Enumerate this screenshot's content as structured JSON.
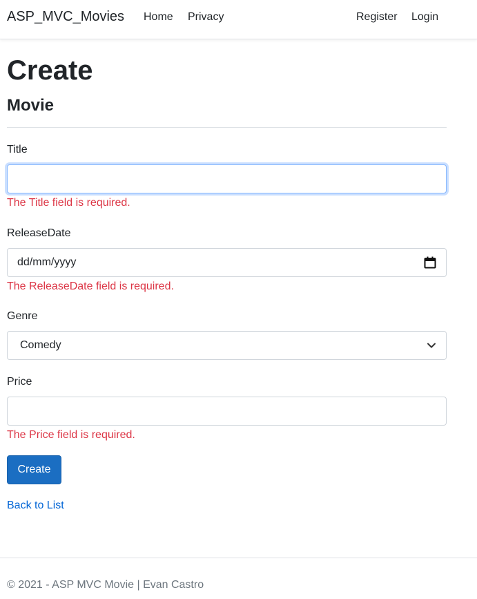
{
  "navbar": {
    "brand": "ASP_MVC_Movies",
    "links": [
      "Home",
      "Privacy"
    ],
    "auth_links": [
      "Register",
      "Login"
    ]
  },
  "page": {
    "title": "Create",
    "subtitle": "Movie"
  },
  "form": {
    "title": {
      "label": "Title",
      "value": "",
      "error": "The Title field is required."
    },
    "release_date": {
      "label": "ReleaseDate",
      "placeholder": "dd/mm/yyyy",
      "error": "The ReleaseDate field is required."
    },
    "genre": {
      "label": "Genre",
      "selected": "Comedy"
    },
    "price": {
      "label": "Price",
      "value": "",
      "error": "The Price field is required."
    },
    "submit_label": "Create"
  },
  "back_link": "Back to List",
  "footer": {
    "text": "© 2021 - ASP MVC Movie | Evan Castro"
  },
  "colors": {
    "primary_button": "#1b6ec2",
    "link": "#0366d6",
    "error": "#dc3545",
    "focus_border": "#86b7fe"
  }
}
